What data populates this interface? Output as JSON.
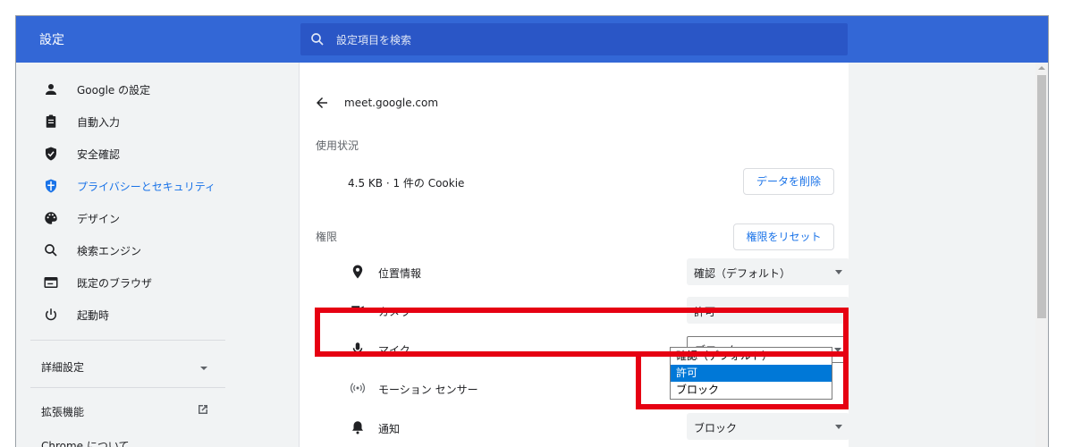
{
  "app": {
    "title": "設定"
  },
  "search": {
    "placeholder": "設定項目を検索"
  },
  "sidebar": {
    "items": [
      {
        "label": "Google の設定",
        "icon": "person-icon"
      },
      {
        "label": "自動入力",
        "icon": "clipboard-icon"
      },
      {
        "label": "安全確認",
        "icon": "shield-check-icon"
      },
      {
        "label": "プライバシーとセキュリティ",
        "icon": "shield-security-icon",
        "active": true
      },
      {
        "label": "デザイン",
        "icon": "palette-icon"
      },
      {
        "label": "検索エンジン",
        "icon": "search-icon"
      },
      {
        "label": "既定のブラウザ",
        "icon": "browser-window-icon"
      },
      {
        "label": "起動時",
        "icon": "power-icon"
      }
    ],
    "advanced": "詳細設定",
    "extensions": "拡張機能",
    "about": "Chrome について"
  },
  "site": {
    "back_icon": "arrow-left-icon",
    "url": "meet.google.com",
    "usage_heading": "使用状況",
    "usage_text": "4.5 KB · 1 件の Cookie",
    "clear_button": "データを削除",
    "permissions_heading": "権限",
    "reset_button": "権限をリセット",
    "permissions": [
      {
        "label": "位置情報",
        "icon": "location-icon",
        "value": "確認（デフォルト）"
      },
      {
        "label": "カメラ",
        "icon": "camera-icon",
        "value": "許可"
      },
      {
        "label": "マイク",
        "icon": "microphone-icon",
        "value": "ブロック"
      },
      {
        "label": "モーション センサー",
        "icon": "motion-sensor-icon",
        "value": ""
      },
      {
        "label": "通知",
        "icon": "bell-icon",
        "value": "ブロック"
      }
    ]
  },
  "dropdown": {
    "options": [
      "確認（デフォルト）",
      "許可",
      "ブロック"
    ],
    "highlighted": "許可"
  },
  "colors": {
    "accent": "#1a73e8",
    "topbar": "#3367d6",
    "highlight": "#e60012"
  }
}
